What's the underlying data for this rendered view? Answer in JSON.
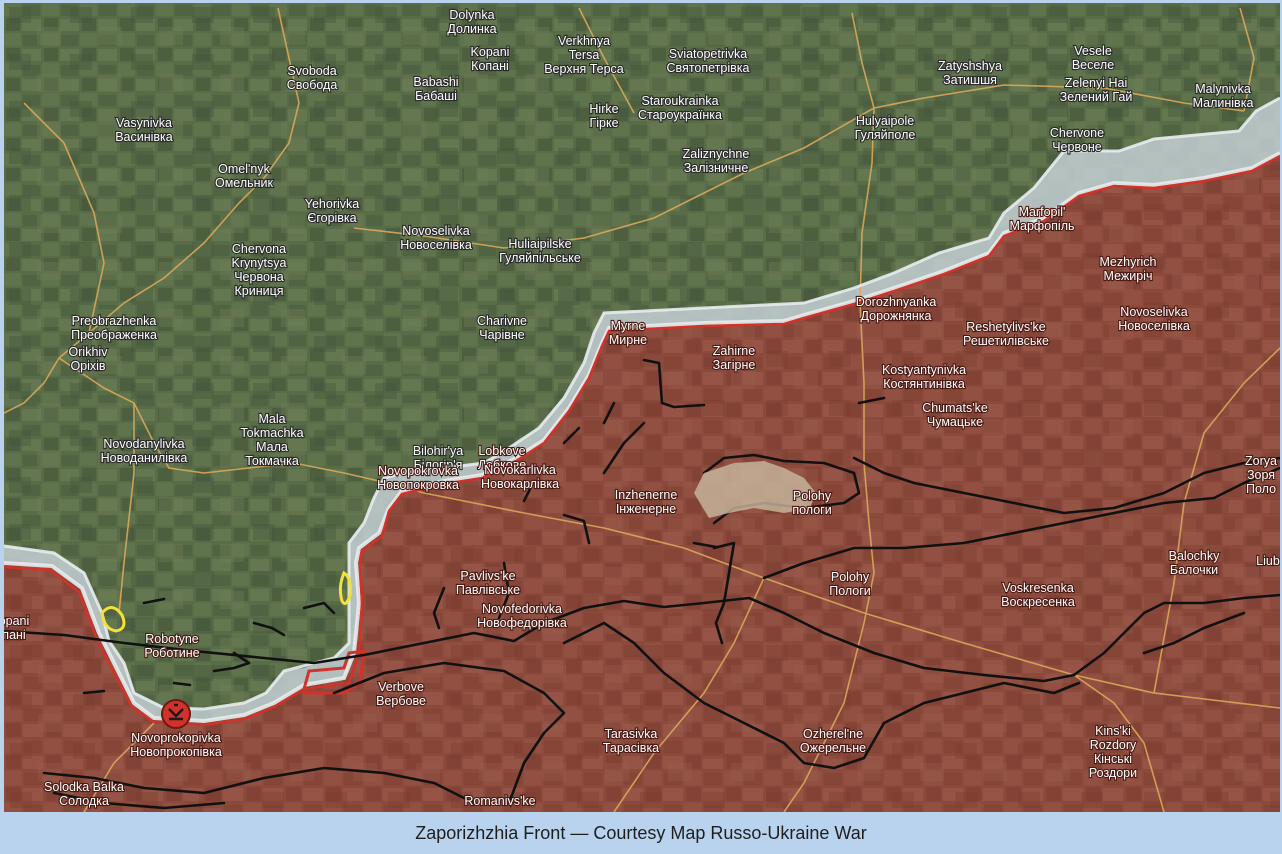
{
  "caption": "Zaporizhzhia Front — Courtesy Map Russo-Ukraine War",
  "colors": {
    "ukraine_terrain": "#5b6e4a",
    "occupied_area": "#8d4a3d",
    "grey_zone": "#c7d3d8",
    "front_line": "#d2322a",
    "trench_lines": "#111111",
    "road": "#d9a85a",
    "contested_marker": "#f2e23a",
    "background": "#b9d3ee"
  },
  "places": [
    {
      "id": "dolynka",
      "lat": "Dolynka",
      "cyr": "Долинка"
    },
    {
      "id": "kopani-n",
      "lat": "Kopani",
      "cyr": "Копані"
    },
    {
      "id": "verkhnya-tersa",
      "lat": "Verkhnya Tersa",
      "cyr": "Верхня Терса"
    },
    {
      "id": "sviatopetrivka",
      "lat": "Sviatopetrivka",
      "cyr": "Святопетрівка"
    },
    {
      "id": "zatyshshya",
      "lat": "Zatyshshya",
      "cyr": "Затишшя"
    },
    {
      "id": "vesele",
      "lat": "Vesele",
      "cyr": "Веселе"
    },
    {
      "id": "zelenyi-hai",
      "lat": "Zelenyi Hai",
      "cyr": "Зелений Гай"
    },
    {
      "id": "malynivka",
      "lat": "Malynivka",
      "cyr": "Малинівка"
    },
    {
      "id": "svoboda",
      "lat": "Svoboda",
      "cyr": "Свобода"
    },
    {
      "id": "babashi",
      "lat": "Babashi",
      "cyr": "Бабаші"
    },
    {
      "id": "hirke",
      "lat": "Hirke",
      "cyr": "Гірке"
    },
    {
      "id": "staroukrainka",
      "lat": "Staroukrainka",
      "cyr": "Староукраїнка"
    },
    {
      "id": "hulyaipole",
      "lat": "Hulyaipole",
      "cyr": "Гуляйполе"
    },
    {
      "id": "chervone",
      "lat": "Chervone",
      "cyr": "Червоне"
    },
    {
      "id": "vasynivka",
      "lat": "Vasynivka",
      "cyr": "Васинівка"
    },
    {
      "id": "zaliznychne",
      "lat": "Zaliznychne",
      "cyr": "Залізничне"
    },
    {
      "id": "omelnyk",
      "lat": "Omel'nyk",
      "cyr": "Омельник"
    },
    {
      "id": "yehorivka",
      "lat": "Yehorivka",
      "cyr": "Єгорівка"
    },
    {
      "id": "marfopil",
      "lat": "Marfopil'",
      "cyr": "Марфопіль"
    },
    {
      "id": "novoselivka-w",
      "lat": "Novoselivka",
      "cyr": "Новоселівка"
    },
    {
      "id": "huliaipilske",
      "lat": "Huliaipilske",
      "cyr": "Гуляйпільське"
    },
    {
      "id": "chervona-krynytsya",
      "lat": "Chervona Krynytsya",
      "cyr": "Червона Криниця"
    },
    {
      "id": "mezhyrich",
      "lat": "Mezhyrich",
      "cyr": "Межиріч"
    },
    {
      "id": "dorozhnyanka",
      "lat": "Dorozhnyanka",
      "cyr": "Дорожнянка"
    },
    {
      "id": "preobrazhenka",
      "lat": "Preobrazhenka",
      "cyr": "Преображенка"
    },
    {
      "id": "reshetylivske",
      "lat": "Reshetylivs'ke",
      "cyr": "Решетилівське"
    },
    {
      "id": "novoselivka-e",
      "lat": "Novoselivka",
      "cyr": "Новоселівка"
    },
    {
      "id": "charivne",
      "lat": "Charivne",
      "cyr": "Чарівне"
    },
    {
      "id": "myrne",
      "lat": "Myrne",
      "cyr": "Мирне"
    },
    {
      "id": "orikhiv",
      "lat": "Orikhiv",
      "cyr": "Оріхів"
    },
    {
      "id": "zahirne",
      "lat": "Zahirne",
      "cyr": "Загірне"
    },
    {
      "id": "kostyantynivka",
      "lat": "Kostyantynivka",
      "cyr": "Костянтинівка"
    },
    {
      "id": "chumatske",
      "lat": "Chumats'ke",
      "cyr": "Чумацьке"
    },
    {
      "id": "mala-tokmachka",
      "lat": "Mala Tokmachka",
      "cyr": "Мала Токмачка"
    },
    {
      "id": "novodanylivka",
      "lat": "Novodanylivka",
      "cyr": "Новоданилівка"
    },
    {
      "id": "bilohirya",
      "lat": "Bilohir'ya",
      "cyr": "Білогір'я"
    },
    {
      "id": "lobkove",
      "lat": "Lobkove",
      "cyr": "Лобкове"
    },
    {
      "id": "novopokrovka",
      "lat": "Novopokrovka",
      "cyr": "Новопокровка"
    },
    {
      "id": "novokarlivka",
      "lat": "Novokarlivka",
      "cyr": "Новокарлівка"
    },
    {
      "id": "polohy-n",
      "lat": "Polohy",
      "cyr": "пологи"
    },
    {
      "id": "zorya",
      "lat": "Zorya",
      "cyr": "Зоря",
      "extra": "Поло"
    },
    {
      "id": "inzhenerne",
      "lat": "Inzhenerne",
      "cyr": "Інженерне"
    },
    {
      "id": "balochky",
      "lat": "Balochky",
      "cyr": "Балочки"
    },
    {
      "id": "liubytske",
      "lat": "Liub",
      "cyr": ""
    },
    {
      "id": "pavlivske",
      "lat": "Pavlivs'ke",
      "cyr": "Павлівське"
    },
    {
      "id": "polohy",
      "lat": "Polohy",
      "cyr": "Пологи"
    },
    {
      "id": "voskresenka",
      "lat": "Voskresenka",
      "cyr": "Воскресенка"
    },
    {
      "id": "kopani-w",
      "lat": "opani",
      "cyr": "пані"
    },
    {
      "id": "novofedorivka",
      "lat": "Novofedorivka",
      "cyr": "Новофедорівка"
    },
    {
      "id": "robotyne",
      "lat": "Robotyne",
      "cyr": "Роботине"
    },
    {
      "id": "verbove",
      "lat": "Verbove",
      "cyr": "Вербове"
    },
    {
      "id": "ozherelne",
      "lat": "Ozherel'ne",
      "cyr": "Ожерельне"
    },
    {
      "id": "kinski-rozdory",
      "lat": "Kins'ki Rozdory",
      "cyr": "Кінські Роздори"
    },
    {
      "id": "novoprokopivka",
      "lat": "Novoprokopivka",
      "cyr": "Новопрокопівка"
    },
    {
      "id": "tarasivka",
      "lat": "Tarasivka",
      "cyr": "Тарасівка"
    },
    {
      "id": "solodka-balka",
      "lat": "Solodka Balka",
      "cyr": "Солодка"
    },
    {
      "id": "romanivske",
      "lat": "Romanivs'ke",
      "cyr": ""
    }
  ]
}
